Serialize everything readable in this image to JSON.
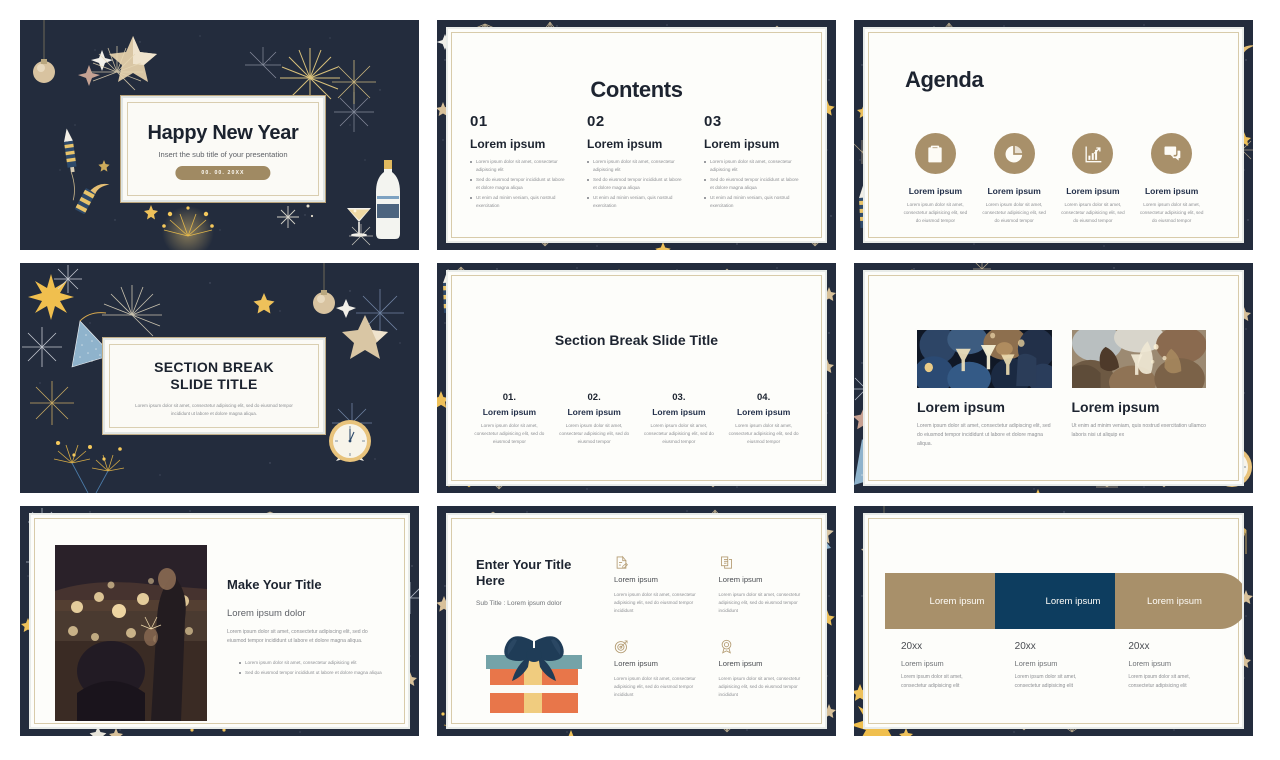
{
  "theme": {
    "dark_navy": "#232c3d",
    "gold": "#a8906a",
    "deep_blue": "#0d3d5f",
    "panel": "#fdfdfa"
  },
  "lorem": {
    "ipsum": "Lorem ipsum",
    "short": "Lorem ipsum dolor sit amet, consectetur adipiscing elit",
    "b1": "Lorem ipsum dolor sit amet, consectetur adipiscing elit",
    "b2": "Sed do eiusmod tempor incididunt ut labore et dolore magna aliqua",
    "b3": "Ut enim ad minim veniam, quis nostrud exercitation",
    "p_agenda": "Lorem ipsum dolor sit amet, consectetur adipisicing elit, sed do eiusmod tempor",
    "p_card": "Lorem ipsum dolor sit amet, consectetur adipisicing elit, sed do eiusmod tempor",
    "p_icon": "Lorem ipsum dolor sit amet, consectetur adipisicing elit, sed do eiusmod tempor incididunt",
    "p_photo1": "Lorem ipsum dolor sit amet, consectetur adipiscing elit, sed do eiusmod tempor incididunt ut labore et dolore magna aliqua.",
    "p_photo2": "Ut enim ad minim veniam, quis nostrud exercitation ullamco laboris nisi ut aliquip ex",
    "p_make": "Lorem ipsum dolor sit amet, consectetur adipiscing elit, sed do eiusmod tempor incididunt ut labore et dolore magna aliqua.",
    "mk_b1": "Lorem ipsum dolor sit amet, consectetur adipisicing elit",
    "mk_b2": "Sed do eiusmod tempor incididunt ut labore et dolore magna aliqua",
    "p_timeline": "Lorem ipsum dolor sit amet, consectetur adipisicing elit",
    "p_section": "Lorem ipsum dolor sit amet, consectetur adipiscing elit, sed do eiusmod tempor incididunt ut labore et dolore magna aliqua."
  },
  "slides": [
    {
      "id": "title-slide",
      "title": "Happy New Year",
      "subtitle": "Insert the sub title of your presentation",
      "date_badge": "00. 00. 20XX"
    },
    {
      "id": "contents-slide",
      "title": "Contents",
      "items": [
        {
          "number": "01",
          "heading": "Lorem ipsum"
        },
        {
          "number": "02",
          "heading": "Lorem ipsum"
        },
        {
          "number": "03",
          "heading": "Lorem ipsum"
        }
      ]
    },
    {
      "id": "agenda-slide",
      "title": "Agenda",
      "items": [
        {
          "icon": "clipboard-checklist-icon",
          "heading": "Lorem ipsum"
        },
        {
          "icon": "pie-chart-icon",
          "heading": "Lorem ipsum"
        },
        {
          "icon": "bar-chart-growth-icon",
          "heading": "Lorem ipsum"
        },
        {
          "icon": "speech-bubbles-icon",
          "heading": "Lorem ipsum"
        }
      ]
    },
    {
      "id": "section-break-slide",
      "title_line1": "SECTION BREAK",
      "title_line2": "SLIDE TITLE"
    },
    {
      "id": "section-break-four-slide",
      "title": "Section Break Slide Title",
      "items": [
        {
          "number": "01.",
          "heading": "Lorem ipsum"
        },
        {
          "number": "02.",
          "heading": "Lorem ipsum"
        },
        {
          "number": "03.",
          "heading": "Lorem ipsum"
        },
        {
          "number": "04.",
          "heading": "Lorem ipsum"
        }
      ]
    },
    {
      "id": "two-photo-slide",
      "items": [
        {
          "heading": "Lorem ipsum",
          "photo": "new-year-toast-photo"
        },
        {
          "heading": "Lorem ipsum",
          "photo": "champagne-pour-photo"
        }
      ]
    },
    {
      "id": "make-your-title-slide",
      "title": "Make Your Title",
      "subheading": "Lorem ipsum dolor",
      "photo": "sparkler-crowd-photo"
    },
    {
      "id": "enter-your-title-slide",
      "title_line1": "Enter Your Title",
      "title_line2": "Here",
      "subtitle": "Sub Title : Lorem ipsum dolor",
      "illustration": "gift-box-illustration",
      "items": [
        {
          "icon": "document-edit-icon",
          "heading": "Lorem ipsum"
        },
        {
          "icon": "document-copy-icon",
          "heading": "Lorem ipsum"
        },
        {
          "icon": "target-dart-icon",
          "heading": "Lorem ipsum"
        },
        {
          "icon": "award-badge-icon",
          "heading": "Lorem ipsum"
        }
      ]
    },
    {
      "id": "timeline-slide",
      "pills": [
        {
          "label": "Lorem ipsum",
          "color": "#a8906a"
        },
        {
          "label": "Lorem ipsum",
          "color": "#0d3d5f"
        },
        {
          "label": "Lorem ipsum",
          "color": "#a8906a"
        }
      ],
      "columns": [
        {
          "year": "20xx",
          "heading": "Lorem ipsum"
        },
        {
          "year": "20xx",
          "heading": "Lorem ipsum"
        },
        {
          "year": "20xx",
          "heading": "Lorem ipsum"
        }
      ]
    }
  ]
}
